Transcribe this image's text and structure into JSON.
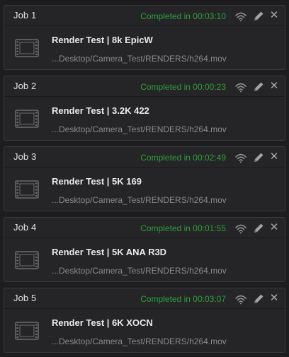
{
  "jobs": [
    {
      "title": "Job 1",
      "status": "Completed in 00:03:10",
      "name": "Render Test | 8k EpicW",
      "path": "...Desktop/Camera_Test/RENDERS/h264.mov"
    },
    {
      "title": "Job 2",
      "status": "Completed in 00:00:23",
      "name": "Render Test | 3.2K 422",
      "path": "...Desktop/Camera_Test/RENDERS/h264.mov"
    },
    {
      "title": "Job 3",
      "status": "Completed in 00:02:49",
      "name": "Render Test | 5K 169",
      "path": "...Desktop/Camera_Test/RENDERS/h264.mov"
    },
    {
      "title": "Job 4",
      "status": "Completed in 00:01:55",
      "name": "Render Test | 5K ANA R3D",
      "path": "...Desktop/Camera_Test/RENDERS/h264.mov"
    },
    {
      "title": "Job 5",
      "status": "Completed in 00:03:07",
      "name": "Render Test | 6K XOCN",
      "path": "...Desktop/Camera_Test/RENDERS/h264.mov"
    }
  ],
  "icons": {
    "remote": "wifi-icon",
    "edit": "pencil-icon",
    "close": "close-icon",
    "clip": "film-clip-icon"
  },
  "colors": {
    "status_completed": "#2f9e3a"
  }
}
